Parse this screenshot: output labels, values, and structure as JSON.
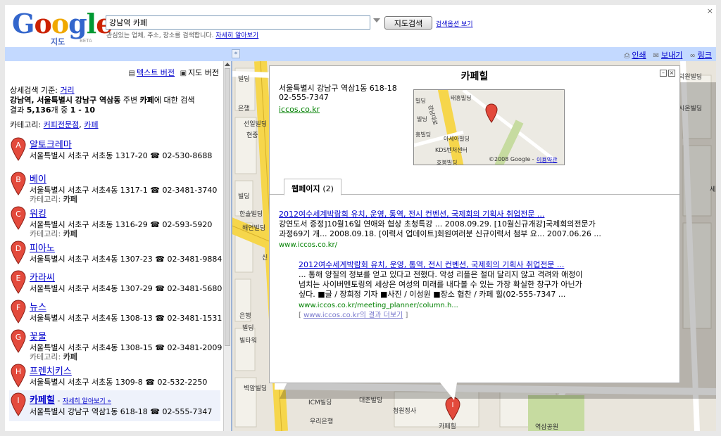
{
  "header": {
    "logo_main": "Google",
    "logo_sub": "지도",
    "logo_beta": "BETA",
    "search_value": "강남역 카페",
    "search_button": "지도검색",
    "options_link": "검색옵션 보기",
    "hint_text": "관심있는 업체, 주소, 장소를 검색합니다.",
    "hint_link": "자세히 알아보기",
    "close": "×"
  },
  "toolbar": {
    "collapse": "«",
    "print": "인쇄",
    "send": "보내기",
    "link": "링크"
  },
  "left": {
    "text_version": "텍스트 버전",
    "map_version": "지도 버전",
    "basis_label": "상세검색 기준:",
    "basis_value": "거리",
    "summary_pre": "강남역, 서울특별시 강남구 역삼동",
    "summary_mid": " 주변 ",
    "summary_kw": "카페",
    "summary_post": "에 대한 검색",
    "count_pre": "결과 ",
    "count_total": "5,136",
    "count_mid": "개 중 ",
    "count_range": "1 - 10",
    "category_label": "카테고리:",
    "category_1": "커피전문점",
    "category_sep": ",",
    "category_2": "카페",
    "category_item_label": "카테고리:",
    "category_item_value": "카페",
    "selected_more": "자세히 알아보기 »",
    "selected_dash": " - ",
    "results": [
      {
        "letter": "A",
        "name": "알토크레마",
        "addr": "서울특별시 서초구 서초동 1317-20 ☎ 02-530-8688"
      },
      {
        "letter": "B",
        "name": "베이",
        "addr": "서울특별시 서초구 서초4동 1317-1 ☎ 02-3481-3740"
      },
      {
        "letter": "C",
        "name": "워킹",
        "addr": "서울특별시 서초구 서초동 1316-29 ☎ 02-593-5920"
      },
      {
        "letter": "D",
        "name": "피아노",
        "addr": "서울특별시 서초구 서초4동 1307-23 ☎ 02-3481-9884"
      },
      {
        "letter": "E",
        "name": "카라씨",
        "addr": "서울특별시 서초구 서초4동 1307-29 ☎ 02-3481-5680"
      },
      {
        "letter": "F",
        "name": "뉴스",
        "addr": "서울특별시 서초구 서초4동 1308-13 ☎ 02-3481-1531"
      },
      {
        "letter": "G",
        "name": "꽃물",
        "addr": "서울특별시 서초구 서초4동 1308-15 ☎ 02-3481-2009"
      },
      {
        "letter": "H",
        "name": "프렌치키스",
        "addr": "서울특별시 서초구 서초동 1309-8 ☎ 02-532-2250"
      },
      {
        "letter": "I",
        "name": "카페힐",
        "addr": "서울특별시 강남구 역삼1동 618-18 ☎ 02-555-7347"
      }
    ]
  },
  "map": {
    "labels": [
      "빌딩",
      "은행",
      "선일빌딩",
      "현중",
      "빌딩",
      "한솔빌딩",
      "해연빌딩",
      "신",
      "은행",
      "빌딩",
      "빌타워",
      "벽암빌딩",
      "ICM빌딩",
      "대준빌딩",
      "청원정사",
      "우리은행",
      "카페힐",
      "역삼공원",
      "시온빌딩",
      "덕원빌딩",
      "세"
    ],
    "marker_letter": "I"
  },
  "info": {
    "title": "카페힐",
    "addr1": "서울특별시 강남구 역삼1동 618-18",
    "phone": "02-555-7347",
    "site": "iccos.co.kr",
    "minimap_labels": [
      "태흥빌딩",
      "빌딩",
      "빌딩",
      "아세아빌딩",
      "KDS벤처센터",
      "흥빌딩",
      "호봉빌딩",
      "©2008 Google -",
      "이용약관",
      "강남대로"
    ],
    "tab_label": "웹페이지",
    "tab_count": "(2)",
    "r1_title": "2012여수세계박람회 유치, 운영, 통역, 전시 컨벤션, 국제회의 기획사 취업전문 ...",
    "r1_snip1": "강연도서 증정]10월16일 연애와 협상 초청특강 ... 2008.09.29. [10월신규개강]국제회의전문가",
    "r1_snip2": "과정69기 개... 2008.09.18. [이력서 업데이트]회원여러분 신규이력서 첨부 요... 2007.06.26 ...",
    "r1_url": "www.iccos.co.kr/",
    "r2_title": "2012여수세계박람회 유치, 운영, 통역, 전시 컨벤션, 국제회의 기획사 취업전문 ...",
    "r2_snip1": "... 통해 양질의 정보를 얻고 있다고 전했다. 악성 리플은 절대 달리지 않고 격려와 애정이",
    "r2_snip2": "넘치는 사이버멘토링의 세상은 여성의 미래를 내다볼 수 있는 가장 확실한 창구가 아닌가",
    "r2_snip3": "싶다. ■글 / 장희정 기자 ■사진 / 이성원 ■장소 협찬 / 카페 힐(02-555-7347 ...",
    "r2_url": "www.iccos.co.kr/meeting_planner/column.h...",
    "r2_more_open": "[ ",
    "r2_more_link": "www.iccos.co.kr의 결과 더보기",
    "r2_more_close": " ]"
  },
  "colors": {
    "pin_red": "#e34a3c",
    "toolbar_blue": "#c3d9ff",
    "road_yellow": "#f6d64b",
    "link_blue": "#0000cc",
    "url_green": "#008000"
  }
}
